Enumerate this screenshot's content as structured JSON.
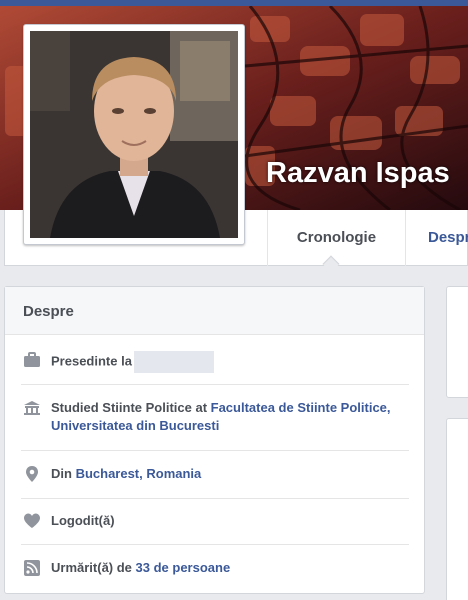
{
  "profile": {
    "name": "Razvan Ispas"
  },
  "tabs": {
    "timeline": "Cronologie",
    "about": "Despre"
  },
  "about": {
    "title": "Despre",
    "work": {
      "prefix": "Presedinte la"
    },
    "education": {
      "prefix": "Studied Stiinte Politice at ",
      "school": "Facultatea de Stiinte Politice, Universitatea din Bucuresti"
    },
    "hometown": {
      "prefix": "Din ",
      "place": "Bucharest, Romania"
    },
    "relationship": {
      "label": "Logodit(ă)"
    },
    "followers": {
      "prefix": "Urmărit(ă) de ",
      "count_label": "33 de persoane"
    }
  },
  "icons": {
    "work": "briefcase-icon",
    "education": "school-icon",
    "hometown": "location-pin-icon",
    "relationship": "heart-icon",
    "followers": "rss-feed-icon"
  },
  "colors": {
    "brand": "#3b5998",
    "link": "#3b5998",
    "text": "#4b4f56",
    "background": "#e9eaed",
    "icon": "#90949c"
  }
}
